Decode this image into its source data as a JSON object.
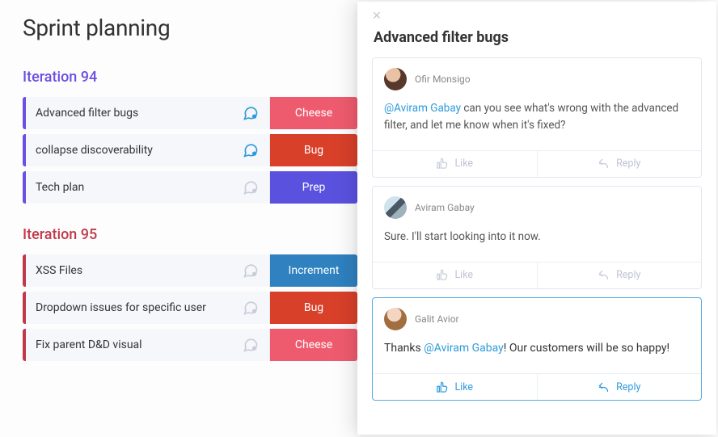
{
  "page_title": "Sprint planning",
  "iterations": [
    {
      "title": "Iteration 94",
      "color": "purple",
      "rows": [
        {
          "text": "Advanced filter bugs",
          "chat_active": true,
          "tag_text": "Cheese",
          "tag_class": "tag-cheese"
        },
        {
          "text": "collapse discoverability",
          "chat_active": true,
          "tag_text": "Bug",
          "tag_class": "tag-bug"
        },
        {
          "text": "Tech plan",
          "chat_active": false,
          "tag_text": "Prep",
          "tag_class": "tag-prep"
        }
      ]
    },
    {
      "title": "Iteration 95",
      "color": "red",
      "rows": [
        {
          "text": "XSS Files",
          "chat_active": false,
          "tag_text": "Increment",
          "tag_class": "tag-increment"
        },
        {
          "text": "Dropdown issues for specific user",
          "chat_active": false,
          "tag_text": "Bug",
          "tag_class": "tag-bug"
        },
        {
          "text": "Fix parent D&D visual",
          "chat_active": false,
          "tag_text": "Cheese",
          "tag_class": "tag-cheese"
        }
      ]
    }
  ],
  "detail": {
    "title": "Advanced filter bugs",
    "like_label": "Like",
    "reply_label": "Reply",
    "comments": [
      {
        "author": "Ofir Monsigo",
        "avatar": "avatar1",
        "mention": "@Aviram Gabay",
        "after_mention": " can you see what's wrong with the advanced filter, and let me know when it's fixed?",
        "active": false,
        "dark": false
      },
      {
        "author": "Aviram Gabay",
        "avatar": "avatar2",
        "before_mention": "Sure. I'll start looking into it now.",
        "active": false,
        "dark": false
      },
      {
        "author": "Galit Avior",
        "avatar": "avatar3",
        "before_mention": "Thanks ",
        "mention": "@Aviram Gabay",
        "after_mention": "! Our customers will be so happy!",
        "active": true,
        "dark": true
      }
    ]
  }
}
